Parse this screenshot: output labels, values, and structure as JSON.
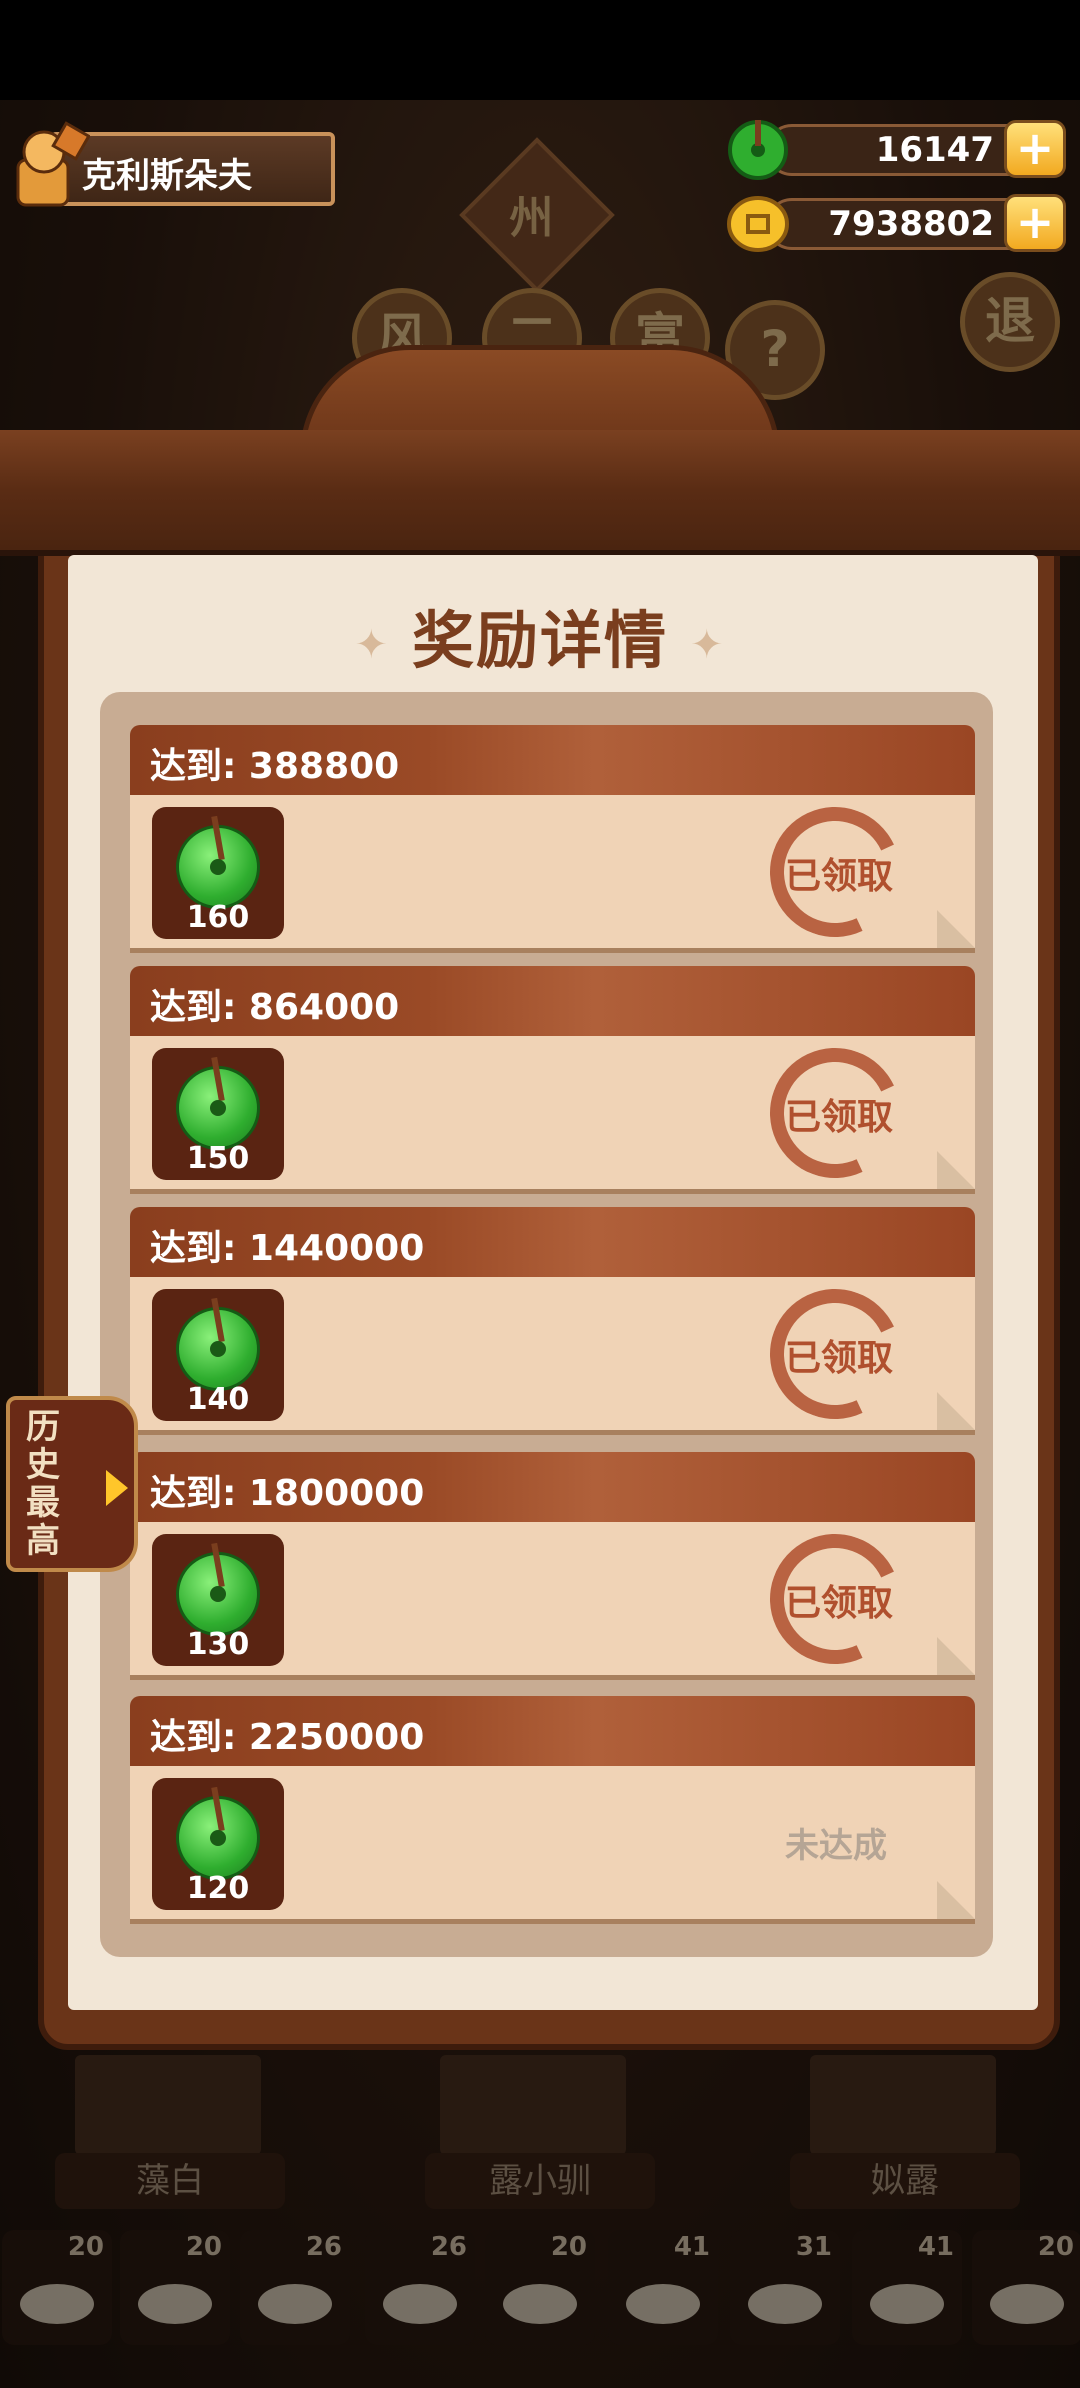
{
  "player": {
    "name": "克利斯朵夫"
  },
  "resources": {
    "jade": "16147",
    "coins": "7938802",
    "plus": "+"
  },
  "background": {
    "state_sign": "州",
    "round_buttons": [
      "风",
      "二",
      "富",
      "?",
      "退"
    ]
  },
  "modal": {
    "title": "奖励详情",
    "rewards": [
      {
        "label": "达到: 388800",
        "amount": "160",
        "status": "已领取"
      },
      {
        "label": "达到: 864000",
        "amount": "150",
        "status": "已领取"
      },
      {
        "label": "达到: 1440000",
        "amount": "140",
        "status": "已领取"
      },
      {
        "label": "达到: 1800000",
        "amount": "130",
        "status": "已领取"
      },
      {
        "label": "达到: 2250000",
        "amount": "120",
        "status": "未达成"
      }
    ]
  },
  "side_tab": {
    "label": "历史最高"
  },
  "characters": [
    "藻白",
    "露小驯",
    "姒露"
  ],
  "dishes": [
    "20",
    "20",
    "26",
    "26",
    "20",
    "41",
    "31",
    "41",
    "20"
  ],
  "colors": {
    "accent": "#7a3e1e",
    "claimed": "#b0502e",
    "pending": "#b5a595",
    "jade": "#2fae2f"
  }
}
